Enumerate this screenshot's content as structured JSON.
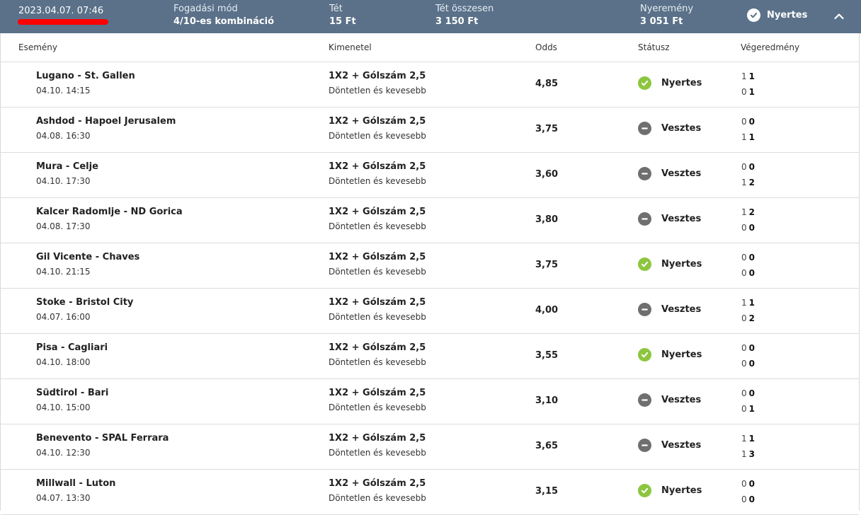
{
  "header": {
    "date": "2023.04.07. 07:46",
    "bet_mode_label": "Fogadási mód",
    "bet_mode_value": "4/10-es kombináció",
    "stake_label": "Tét",
    "stake_value": "15 Ft",
    "total_stake_label": "Tét összesen",
    "total_stake_value": "3 150 Ft",
    "winnings_label": "Nyeremény",
    "winnings_value": "3 051 Ft",
    "status": "Nyertes",
    "colors": {
      "bar": "#5a7189",
      "win": "#8cc63f",
      "lose": "#6f6f6f"
    },
    "icons": {
      "status": "check-circle-icon",
      "collapse": "chevron-up-icon"
    }
  },
  "columns": {
    "event": "Esemény",
    "outcome": "Kimenetel",
    "odds": "Odds",
    "status": "Státusz",
    "result": "Végeredmény"
  },
  "rows": [
    {
      "event": "Lugano - St. Gallen",
      "date": "04.10. 14:15",
      "market": "1X2 + Gólszám 2,5",
      "selection": "Döntetlen és kevesebb",
      "odds": "4,85",
      "status": "Nyertes",
      "win": true,
      "home_ht": "1",
      "home_ft": "1",
      "away_ht": "0",
      "away_ft": "1"
    },
    {
      "event": "Ashdod - Hapoel Jerusalem",
      "date": "04.08. 16:30",
      "market": "1X2 + Gólszám 2,5",
      "selection": "Döntetlen és kevesebb",
      "odds": "3,75",
      "status": "Vesztes",
      "win": false,
      "home_ht": "0",
      "home_ft": "0",
      "away_ht": "1",
      "away_ft": "1"
    },
    {
      "event": "Mura - Celje",
      "date": "04.10. 17:30",
      "market": "1X2 + Gólszám 2,5",
      "selection": "Döntetlen és kevesebb",
      "odds": "3,60",
      "status": "Vesztes",
      "win": false,
      "home_ht": "0",
      "home_ft": "0",
      "away_ht": "1",
      "away_ft": "2"
    },
    {
      "event": "Kalcer Radomlje - ND Gorica",
      "date": "04.08. 17:30",
      "market": "1X2 + Gólszám 2,5",
      "selection": "Döntetlen és kevesebb",
      "odds": "3,80",
      "status": "Vesztes",
      "win": false,
      "home_ht": "1",
      "home_ft": "2",
      "away_ht": "0",
      "away_ft": "0"
    },
    {
      "event": "Gil Vicente - Chaves",
      "date": "04.10. 21:15",
      "market": "1X2 + Gólszám 2,5",
      "selection": "Döntetlen és kevesebb",
      "odds": "3,75",
      "status": "Nyertes",
      "win": true,
      "home_ht": "0",
      "home_ft": "0",
      "away_ht": "0",
      "away_ft": "0"
    },
    {
      "event": "Stoke - Bristol City",
      "date": "04.07. 16:00",
      "market": "1X2 + Gólszám 2,5",
      "selection": "Döntetlen és kevesebb",
      "odds": "4,00",
      "status": "Vesztes",
      "win": false,
      "home_ht": "1",
      "home_ft": "1",
      "away_ht": "0",
      "away_ft": "2"
    },
    {
      "event": "Pisa - Cagliari",
      "date": "04.10. 18:00",
      "market": "1X2 + Gólszám 2,5",
      "selection": "Döntetlen és kevesebb",
      "odds": "3,55",
      "status": "Nyertes",
      "win": true,
      "home_ht": "0",
      "home_ft": "0",
      "away_ht": "0",
      "away_ft": "0"
    },
    {
      "event": "Südtirol - Bari",
      "date": "04.10. 15:00",
      "market": "1X2 + Gólszám 2,5",
      "selection": "Döntetlen és kevesebb",
      "odds": "3,10",
      "status": "Vesztes",
      "win": false,
      "home_ht": "0",
      "home_ft": "0",
      "away_ht": "0",
      "away_ft": "1"
    },
    {
      "event": "Benevento - SPAL Ferrara",
      "date": "04.10. 12:30",
      "market": "1X2 + Gólszám 2,5",
      "selection": "Döntetlen és kevesebb",
      "odds": "3,65",
      "status": "Vesztes",
      "win": false,
      "home_ht": "1",
      "home_ft": "1",
      "away_ht": "1",
      "away_ft": "3"
    },
    {
      "event": "Millwall - Luton",
      "date": "04.07. 13:30",
      "market": "1X2 + Gólszám 2,5",
      "selection": "Döntetlen és kevesebb",
      "odds": "3,15",
      "status": "Nyertes",
      "win": true,
      "home_ht": "0",
      "home_ft": "0",
      "away_ht": "0",
      "away_ft": "0"
    }
  ]
}
